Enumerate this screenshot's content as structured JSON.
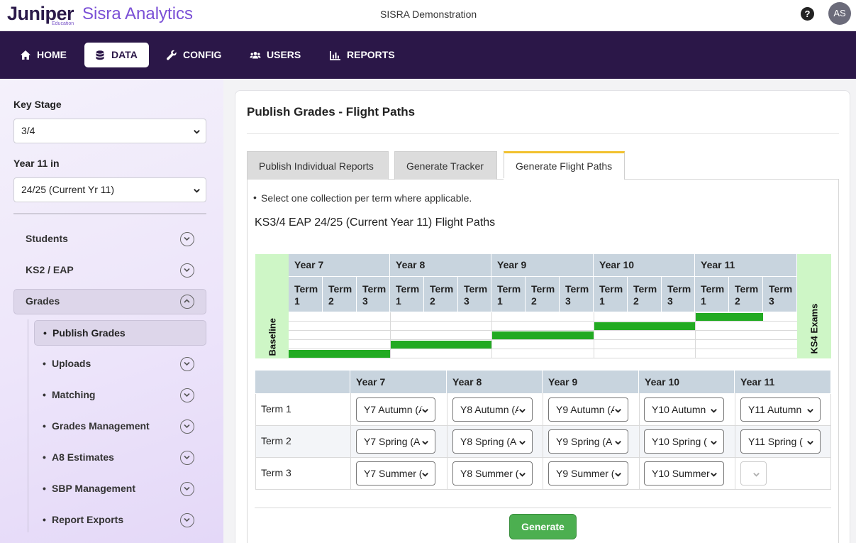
{
  "header": {
    "brand_main": "Juniper",
    "brand_sub": "Education",
    "brand_product": "Sisra Analytics",
    "center_title": "SISRA Demonstration",
    "help": "?",
    "avatar_initials": "AS"
  },
  "nav": {
    "home": "HOME",
    "data": "DATA",
    "config": "CONFIG",
    "users": "USERS",
    "reports": "REPORTS"
  },
  "sidebar": {
    "key_stage_label": "Key Stage",
    "key_stage_value": "3/4",
    "year_label": "Year 11 in",
    "year_value": "24/25 (Current Yr 11)",
    "menu": {
      "students": "Students",
      "ks2_eap": "KS2 / EAP",
      "grades": "Grades"
    },
    "submenu": {
      "publish_grades": "Publish Grades",
      "uploads": "Uploads",
      "matching": "Matching",
      "grades_management": "Grades Management",
      "a8_estimates": "A8 Estimates",
      "sbp_management": "SBP Management",
      "report_exports": "Report Exports"
    },
    "bullet": "•"
  },
  "main": {
    "page_title": "Publish Grades - Flight Paths",
    "tabs": {
      "individual": "Publish Individual Reports",
      "tracker": "Generate Tracker",
      "flight": "Generate Flight Paths"
    },
    "instruction": "Select one collection per term where applicable.",
    "flight_title": "KS3/4 EAP 24/25 (Current Year 11) Flight Paths",
    "grid": {
      "baseline": "Baseline",
      "ks4": "KS4 Exams",
      "years": [
        "Year 7",
        "Year 8",
        "Year 9",
        "Year 10",
        "Year 11"
      ],
      "terms": [
        {
          "l1": "Term",
          "l2": "1"
        },
        {
          "l1": "Term",
          "l2": "2"
        },
        {
          "l1": "Term",
          "l2": "3"
        }
      ]
    },
    "table": {
      "years": [
        "Year 7",
        "Year 8",
        "Year 9",
        "Year 10",
        "Year 11"
      ],
      "term_labels": [
        "Term 1",
        "Term 2",
        "Term 3"
      ],
      "selects": {
        "t1": [
          "Y7 Autumn (A",
          "Y8 Autumn (A",
          "Y9 Autumn (A",
          "Y10 Autumn",
          "Y11 Autumn"
        ],
        "t2": [
          "Y7 Spring (A",
          "Y8 Spring (A",
          "Y9 Spring (A",
          "Y10 Spring (",
          "Y11 Spring ("
        ],
        "t3": [
          "Y7 Summer (",
          "Y8 Summer (",
          "Y9 Summer (",
          "Y10 Summer",
          ""
        ]
      }
    },
    "generate_label": "Generate"
  }
}
